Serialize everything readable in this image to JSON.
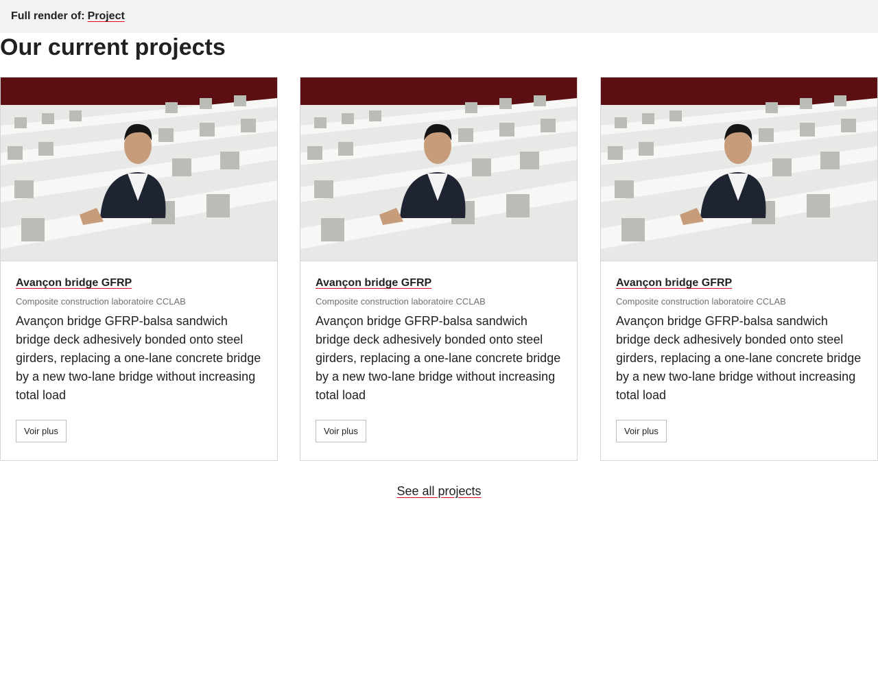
{
  "render_bar": {
    "label": "Full render of:",
    "link": "Project"
  },
  "page_title": "Our current projects",
  "cards": [
    {
      "title": "Avançon bridge GFRP",
      "subtitle": "Composite construction laboratoire CCLAB",
      "description": "Avançon bridge GFRP-balsa sandwich bridge deck adhesively bonded onto steel girders, replacing a one-lane concrete bridge by a new two-lane bridge without increasing total load",
      "button": "Voir plus"
    },
    {
      "title": "Avançon bridge GFRP",
      "subtitle": "Composite construction laboratoire CCLAB",
      "description": "Avançon bridge GFRP-balsa sandwich bridge deck adhesively bonded onto steel girders, replacing a one-lane concrete bridge by a new two-lane bridge without increasing total load",
      "button": "Voir plus"
    },
    {
      "title": "Avançon bridge GFRP",
      "subtitle": "Composite construction laboratoire CCLAB",
      "description": "Avançon bridge GFRP-balsa sandwich bridge deck adhesively bonded onto steel girders, replacing a one-lane concrete bridge by a new two-lane bridge without increasing total load",
      "button": "Voir plus"
    }
  ],
  "see_all": "See all projects",
  "colors": {
    "accent_underline": "#e2001a",
    "header_bg": "#f2f2f4",
    "photo_backdrop": "#5c0f12"
  }
}
